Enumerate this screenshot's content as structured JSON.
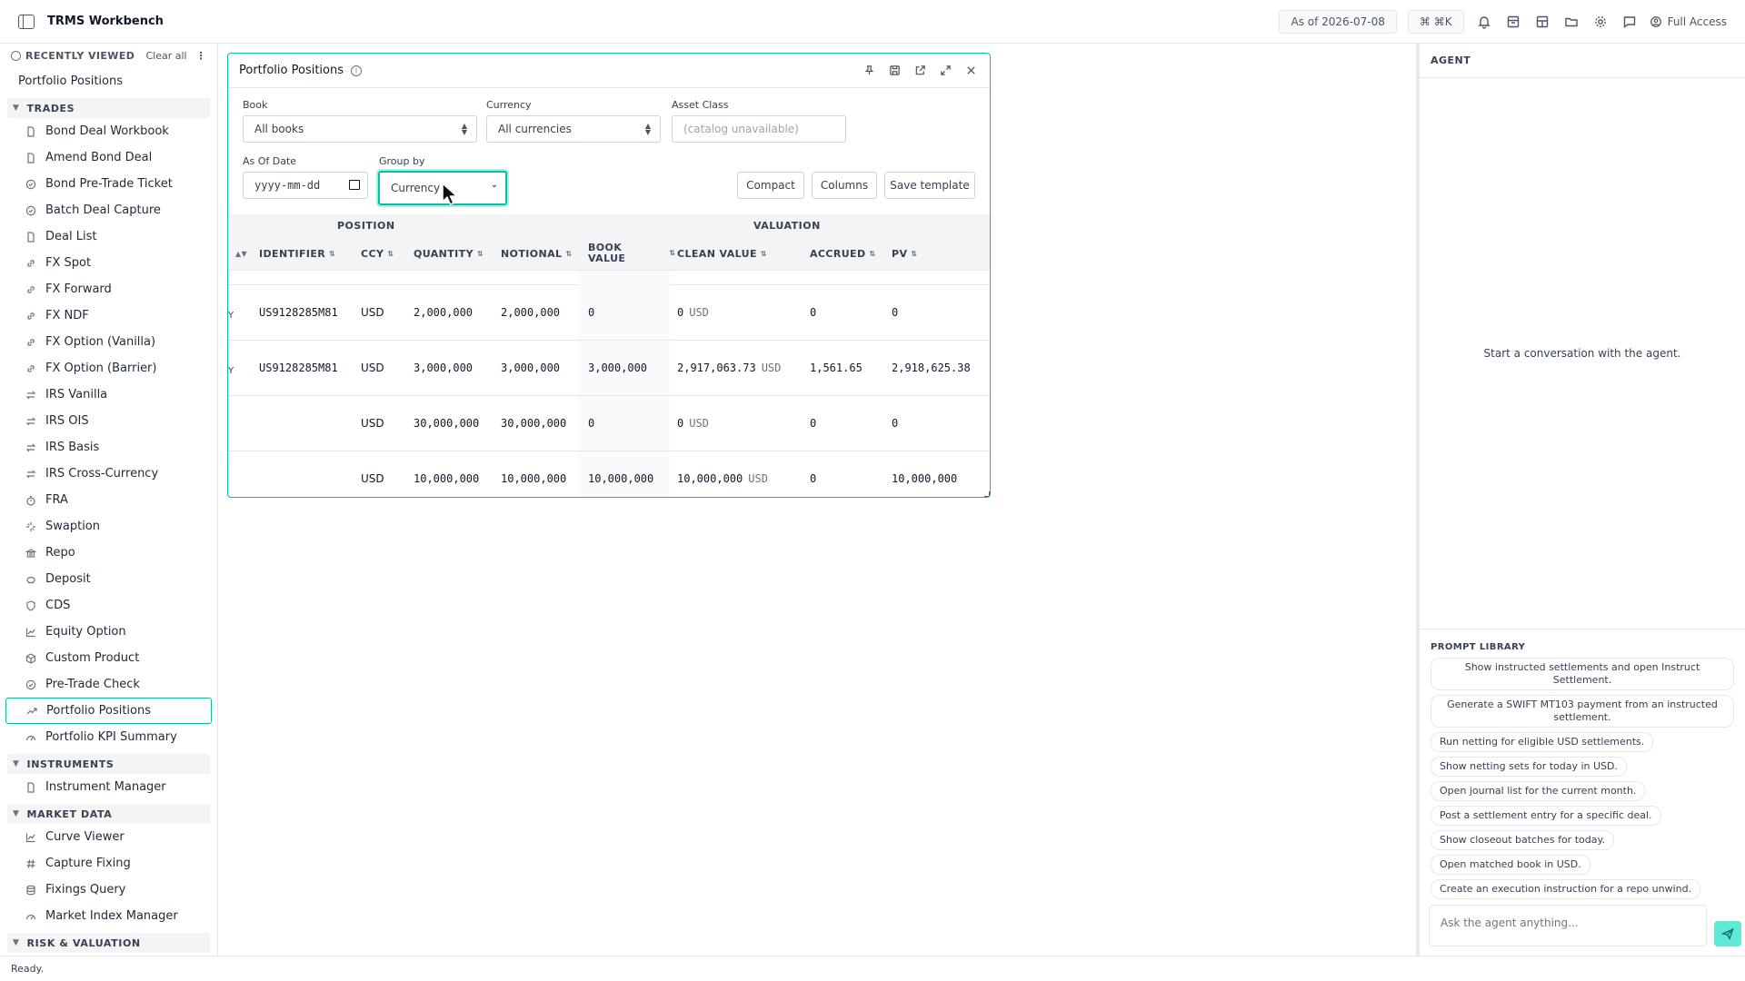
{
  "app": {
    "title": "TRMS Workbench"
  },
  "topbar": {
    "as_of": "As of 2026-07-08",
    "shortcut": "⌘ ⌘K",
    "full_access": "Full Access"
  },
  "sidebar": {
    "recently_viewed_label": "RECENTLY VIEWED",
    "clear_all": "Clear all",
    "recent_items": [
      "Portfolio Positions"
    ],
    "sections": [
      {
        "title": "TRADES",
        "items": [
          {
            "label": "Bond Deal Workbook",
            "icon": "document-icon"
          },
          {
            "label": "Amend Bond Deal",
            "icon": "document-icon"
          },
          {
            "label": "Bond Pre-Trade Ticket",
            "icon": "check-circle-icon"
          },
          {
            "label": "Batch Deal Capture",
            "icon": "check-circle-icon"
          },
          {
            "label": "Deal List",
            "icon": "document-icon"
          },
          {
            "label": "FX Spot",
            "icon": "link-icon"
          },
          {
            "label": "FX Forward",
            "icon": "link-icon"
          },
          {
            "label": "FX NDF",
            "icon": "link-icon"
          },
          {
            "label": "FX Option (Vanilla)",
            "icon": "link-icon"
          },
          {
            "label": "FX Option (Barrier)",
            "icon": "link-icon"
          },
          {
            "label": "IRS Vanilla",
            "icon": "swap-icon"
          },
          {
            "label": "IRS OIS",
            "icon": "swap-icon"
          },
          {
            "label": "IRS Basis",
            "icon": "swap-icon"
          },
          {
            "label": "IRS Cross-Currency",
            "icon": "swap-icon"
          },
          {
            "label": "FRA",
            "icon": "timer-icon"
          },
          {
            "label": "Swaption",
            "icon": "sparkle-icon"
          },
          {
            "label": "Repo",
            "icon": "bank-icon"
          },
          {
            "label": "Deposit",
            "icon": "piggy-bank-icon"
          },
          {
            "label": "CDS",
            "icon": "shield-icon"
          },
          {
            "label": "Equity Option",
            "icon": "line-chart-icon"
          },
          {
            "label": "Custom Product",
            "icon": "box-icon"
          },
          {
            "label": "Pre-Trade Check",
            "icon": "check-circle-icon"
          },
          {
            "label": "Portfolio Positions",
            "icon": "trending-up-icon",
            "active": true
          },
          {
            "label": "Portfolio KPI Summary",
            "icon": "gauge-icon"
          }
        ]
      },
      {
        "title": "INSTRUMENTS",
        "items": [
          {
            "label": "Instrument Manager",
            "icon": "document-icon"
          }
        ]
      },
      {
        "title": "MARKET DATA",
        "items": [
          {
            "label": "Curve Viewer",
            "icon": "line-chart-icon"
          },
          {
            "label": "Capture Fixing",
            "icon": "hash-icon"
          },
          {
            "label": "Fixings Query",
            "icon": "database-icon"
          },
          {
            "label": "Market Index Manager",
            "icon": "gauge-icon"
          }
        ]
      },
      {
        "title": "RISK & VALUATION",
        "items": []
      }
    ]
  },
  "panel": {
    "title": "Portfolio Positions",
    "filters": {
      "book_label": "Book",
      "book_value": "All books",
      "currency_label": "Currency",
      "currency_value": "All currencies",
      "asset_class_label": "Asset Class",
      "asset_class_placeholder": "(catalog unavailable)",
      "as_of_label": "As Of Date",
      "as_of_placeholder": "yyyy-mm-dd",
      "group_by_label": "Group by",
      "group_by_value": "Currency"
    },
    "buttons": {
      "compact": "Compact",
      "columns": "Columns",
      "save_template": "Save template"
    },
    "grid": {
      "groups": {
        "position": "POSITION",
        "valuation": "VALUATION"
      },
      "columns": {
        "identifier": "IDENTIFIER",
        "ccy": "CCY",
        "quantity": "QUANTITY",
        "notional": "NOTIONAL",
        "book_value_1": "BOOK",
        "book_value_2": "VALUE",
        "clean_value": "CLEAN VALUE",
        "accrued": "ACCRUED",
        "pv": "PV"
      },
      "rows": [
        {
          "mark": "Y",
          "identifier": "US9128285M81",
          "ccy": "USD",
          "quantity": "2,000,000",
          "notional": "2,000,000",
          "book_value": "0",
          "clean_value": "0",
          "clean_unit": "USD",
          "accrued": "0",
          "pv": "0"
        },
        {
          "mark": "Y",
          "identifier": "US9128285M81",
          "ccy": "USD",
          "quantity": "3,000,000",
          "notional": "3,000,000",
          "book_value": "3,000,000",
          "clean_value": "2,917,063.73",
          "clean_unit": "USD",
          "accrued": "1,561.65",
          "pv": "2,918,625.38"
        },
        {
          "mark": "",
          "identifier": "",
          "ccy": "USD",
          "quantity": "30,000,000",
          "notional": "30,000,000",
          "book_value": "0",
          "clean_value": "0",
          "clean_unit": "USD",
          "accrued": "0",
          "pv": "0"
        },
        {
          "mark": "",
          "identifier": "",
          "ccy": "USD",
          "quantity": "10,000,000",
          "notional": "10,000,000",
          "book_value": "10,000,000",
          "clean_value": "10,000,000",
          "clean_unit": "USD",
          "accrued": "0",
          "pv": "10,000,000"
        }
      ]
    }
  },
  "agent": {
    "title": "AGENT",
    "empty_state": "Start a conversation with the agent.",
    "prompt_library_title": "PROMPT LIBRARY",
    "prompts": [
      "Show instructed settlements and open Instruct Settlement.",
      "Generate a SWIFT MT103 payment from an instructed settlement.",
      "Run netting for eligible USD settlements.",
      "Show netting sets for today in USD.",
      "Open journal list for the current month.",
      "Post a settlement entry for a specific deal.",
      "Show closeout batches for today.",
      "Open matched book in USD.",
      "Create an execution instruction for a repo unwind."
    ],
    "input_placeholder": "Ask the agent anything..."
  },
  "status": {
    "text": "Ready."
  },
  "colors": {
    "accent": "#14b8a6",
    "send_button": "#5eead4"
  }
}
